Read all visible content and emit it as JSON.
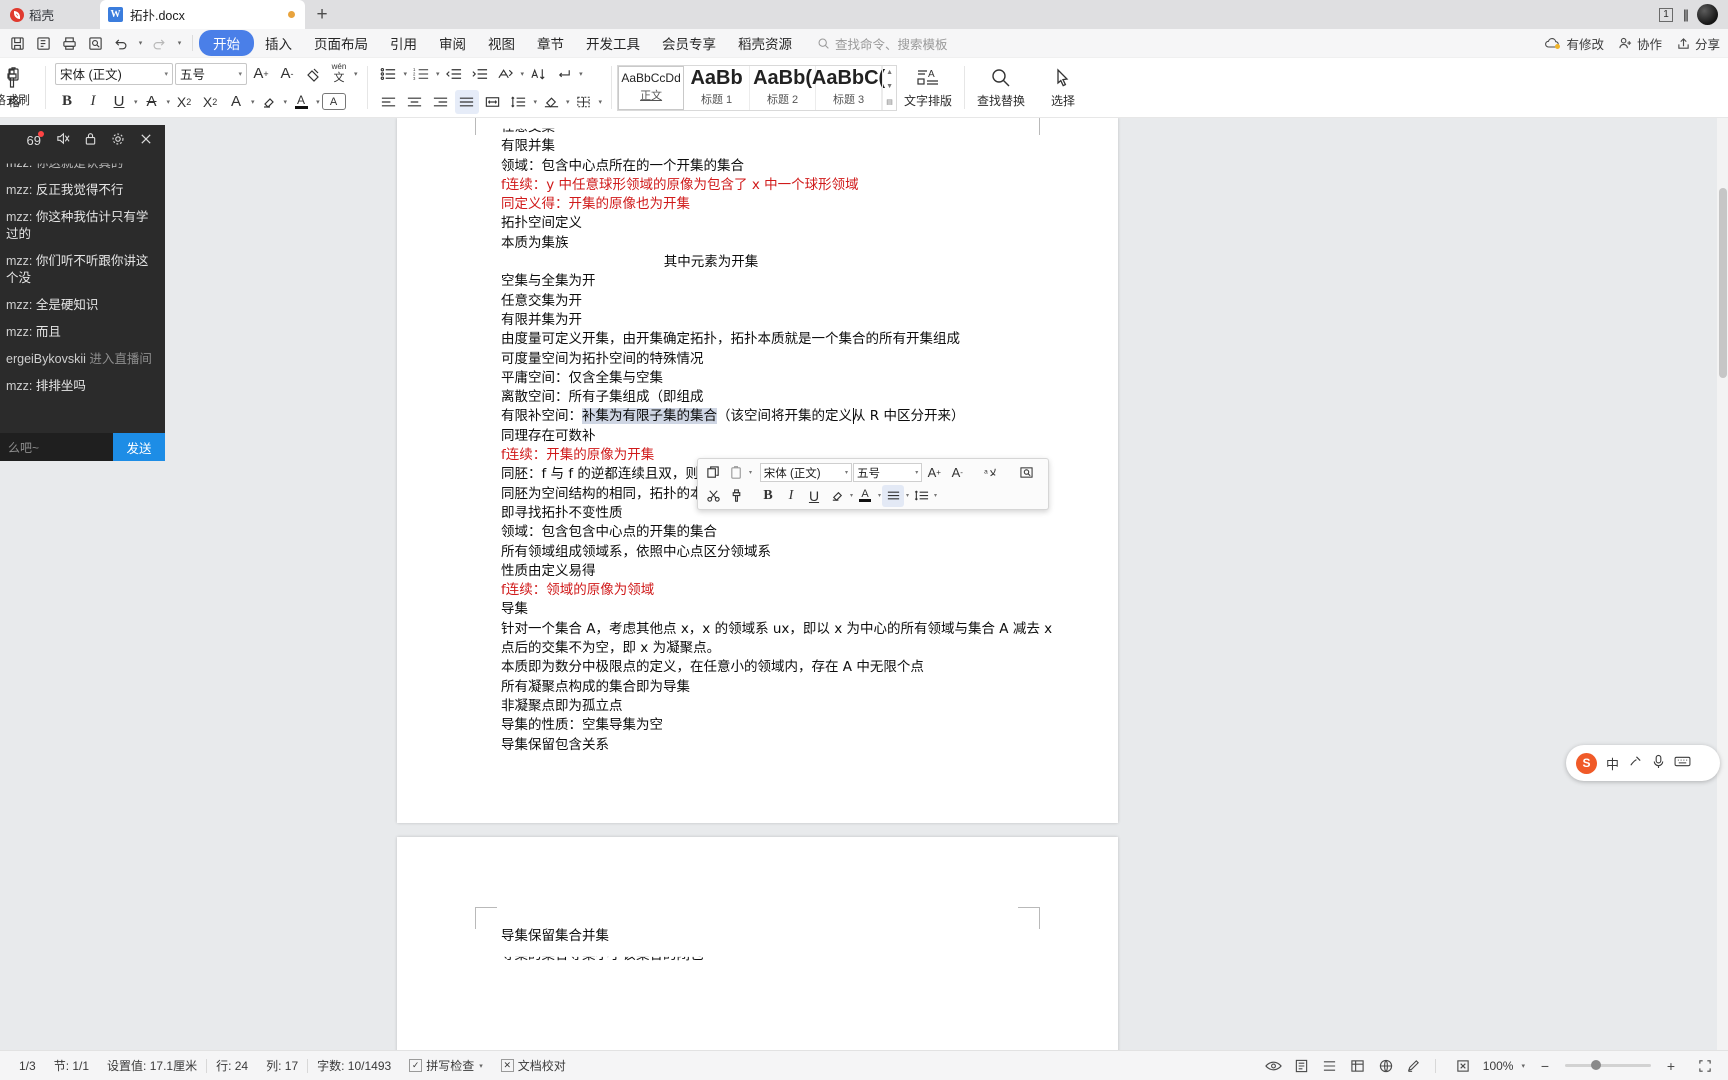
{
  "tabbar": {
    "docer_label": "稻壳",
    "doc_tab": "拓扑.docx",
    "new_tab": "+",
    "window_count": "1"
  },
  "ribbon": {
    "quick_access": [
      "save-icon",
      "save-as-icon",
      "print-icon",
      "print-preview-icon",
      "undo-icon",
      "redo-icon",
      "customize-icon"
    ],
    "tabs": [
      {
        "label": "开始",
        "active": true
      },
      {
        "label": "插入",
        "active": false
      },
      {
        "label": "页面布局",
        "active": false
      },
      {
        "label": "引用",
        "active": false
      },
      {
        "label": "审阅",
        "active": false
      },
      {
        "label": "视图",
        "active": false
      },
      {
        "label": "章节",
        "active": false
      },
      {
        "label": "开发工具",
        "active": false
      },
      {
        "label": "会员专享",
        "active": false
      },
      {
        "label": "稻壳资源",
        "active": false
      }
    ],
    "search_placeholder": "查找命令、搜索模板",
    "right": [
      {
        "label": "有修改",
        "icon": "cloud-modified-icon"
      },
      {
        "label": "协作",
        "icon": "collaborate-icon"
      },
      {
        "label": "分享",
        "icon": "share-icon"
      }
    ]
  },
  "toolbar": {
    "format_brush": "格式刷",
    "font_name": "宋体 (正文)",
    "font_size": "五号",
    "buttons": {
      "bold": "B",
      "italic": "I",
      "underline": "U",
      "strikethrough": "A",
      "superscript": "X²",
      "subscript": "X₂",
      "text_effect": "A",
      "highlight": "A",
      "font_color": "A",
      "char_border": "A",
      "grow_font": "A⁺",
      "shrink_font": "A⁻",
      "clear_format": "clear-format-icon",
      "pinyin": "pinyin-icon"
    },
    "styles": [
      {
        "preview": "AaBbCcDd",
        "label": "正文",
        "selected": true
      },
      {
        "preview": "AaBb",
        "label": "标题 1",
        "selected": false
      },
      {
        "preview": "AaBb(",
        "label": "标题 2",
        "selected": false
      },
      {
        "preview": "AaBbC(",
        "label": "标题 3",
        "selected": false
      }
    ],
    "text_layout": "文字排版",
    "find_replace": "查找替换",
    "select": "选择"
  },
  "mini_toolbar": {
    "row1": [
      "copy-icon",
      "paste-icon"
    ],
    "font_name": "宋体 (正文)",
    "font_size": "五号",
    "grow_font": "A⁺",
    "shrink_font": "A⁻",
    "translate": "翻译",
    "search_library": "搜文库",
    "row2": [
      "cut-icon",
      "format-brush-icon",
      "bold",
      "italic",
      "underline",
      "highlight",
      "font-color",
      "align",
      "line-spacing"
    ]
  },
  "document": {
    "lines": [
      {
        "t": "任意交集",
        "cls": "clipped"
      },
      {
        "t": "有限并集",
        "cls": ""
      },
      {
        "t": "领域：包含中心点所在的一个开集的集合",
        "cls": ""
      },
      {
        "t": "f连续：y 中任意球形领域的原像为包含了 x 中一个球形领域",
        "cls": "red"
      },
      {
        "t": "同定义得：开集的原像也为开集",
        "cls": "red"
      },
      {
        "t": "拓扑空间定义",
        "cls": ""
      },
      {
        "t": "本质为集族",
        "cls": ""
      },
      {
        "t": "其中元素为开集",
        "cls": "center"
      },
      {
        "t": "空集与全集为开",
        "cls": ""
      },
      {
        "t": "任意交集为开",
        "cls": ""
      },
      {
        "t": "有限并集为开",
        "cls": ""
      },
      {
        "t": "由度量可定义开集，由开集确定拓扑，拓扑本质就是一个集合的所有开集组成",
        "cls": ""
      },
      {
        "t": "可度量空间为拓扑空间的特殊情况",
        "cls": ""
      },
      {
        "t": "平庸空间：仅含全集与空集",
        "cls": ""
      },
      {
        "t": "离散空间：所有子集组成（即组成",
        "cls": ""
      },
      {
        "t": "有限补空间：补集为有限子集的集合（该空间将开集的定义从 R 中区分开来）",
        "cls": "highlighted"
      },
      {
        "t": "同理存在可数补",
        "cls": ""
      },
      {
        "t": "f连续：开集的原像为开集",
        "cls": "red"
      },
      {
        "t": "同胚：f 与 f 的逆都连续且双，则为同胚",
        "cls": ""
      },
      {
        "t": "同胚为空间结构的相同，拓扑的本质即为空间归类",
        "cls": ""
      },
      {
        "t": "即寻找拓扑不变性质",
        "cls": ""
      },
      {
        "t": "领域：包含包含中心点的开集的集合",
        "cls": ""
      },
      {
        "t": "所有领域组成领域系，依照中心点区分领域系",
        "cls": ""
      },
      {
        "t": "性质由定义易得",
        "cls": ""
      },
      {
        "t": "f连续：领域的原像为领域",
        "cls": "red"
      },
      {
        "t": "导集",
        "cls": ""
      },
      {
        "t": "针对一个集合 A，考虑其他点 x，x 的领域系 ux，即以 x 为中心的所有领域与集合 A 减去 x",
        "cls": ""
      },
      {
        "t": "点后的交集不为空，即 x 为凝聚点。",
        "cls": ""
      },
      {
        "t": "本质即为数分中极限点的定义，在任意小的领域内，存在 A 中无限个点",
        "cls": ""
      },
      {
        "t": "所有凝聚点构成的集合即为导集",
        "cls": ""
      },
      {
        "t": "非凝聚点即为孤立点",
        "cls": ""
      },
      {
        "t": "导集的性质：空集导集为空",
        "cls": ""
      },
      {
        "t": "导集保留包含关系",
        "cls": ""
      }
    ],
    "page2_lines": [
      {
        "t": "导集保留集合并集",
        "cls": ""
      },
      {
        "t": "导集的集合导集小于该集合的闭包",
        "cls": "clipped"
      }
    ]
  },
  "chat": {
    "header_icons": [
      "gift-icon",
      "mute-icon",
      "lock-icon",
      "settings-icon",
      "close-icon"
    ],
    "messages": [
      {
        "name": "mzz:",
        "text": "你这就是认真的",
        "clipped": true
      },
      {
        "name": "mzz:",
        "text": "反正我觉得不行"
      },
      {
        "name": "mzz:",
        "text": "你这种我估计只有学过的"
      },
      {
        "name": "mzz:",
        "text": "你们听不听跟你讲这个没"
      },
      {
        "name": "mzz:",
        "text": "全是硬知识"
      },
      {
        "name": "mzz:",
        "text": "而且"
      },
      {
        "name": "ergeiBykovskii",
        "text": "进入直播间",
        "join": true
      },
      {
        "name": "mzz:",
        "text": "排排坐吗"
      }
    ],
    "input_placeholder": "么吧~",
    "send_label": "发送"
  },
  "ime": {
    "logo": "S",
    "mode": "中",
    "items": [
      "中",
      "voice-icon",
      "mic-icon",
      "keyboard-icon"
    ]
  },
  "statusbar": {
    "page": "1/3",
    "section": "节: 1/1",
    "setting": "设置值: 17.1厘米",
    "row": "行: 24",
    "col": "列: 17",
    "wordcount": "字数: 10/1493",
    "spellcheck": "拼写检查",
    "proofread": "文档校对",
    "zoom": "100%",
    "right_icons": [
      "eye-icon",
      "page-view-icon",
      "web-view-icon",
      "outline-view-icon",
      "reading-view-icon",
      "pen-icon",
      "fit-icon",
      "zoom-out-icon",
      "zoom-in-icon",
      "fullscreen-icon"
    ]
  }
}
